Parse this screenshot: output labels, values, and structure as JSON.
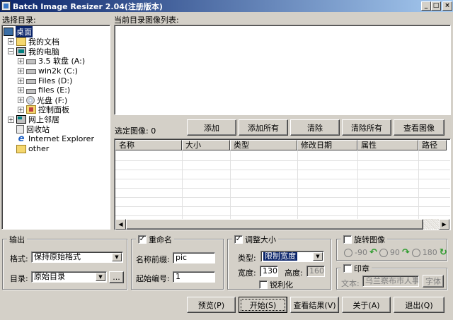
{
  "window": {
    "title": "Batch Image Resizer 2.04(注册版本)",
    "min_glyph": "_",
    "max_glyph": "□",
    "close_glyph": "×"
  },
  "left": {
    "header": "选择目录:",
    "tree": [
      {
        "label": "桌面",
        "icon": "desktop-icon",
        "level": 0,
        "expander": "",
        "selected": true
      },
      {
        "label": "我的文档",
        "icon": "folder-icon",
        "level": 1,
        "expander": "+"
      },
      {
        "label": "我的电脑",
        "icon": "computer-icon",
        "level": 1,
        "expander": "−"
      },
      {
        "label": "3.5 软盘 (A:)",
        "icon": "floppy-icon",
        "level": 2,
        "expander": "+"
      },
      {
        "label": "win2k (C:)",
        "icon": "drive-icon",
        "level": 2,
        "expander": "+"
      },
      {
        "label": "Files (D:)",
        "icon": "drive-icon",
        "level": 2,
        "expander": "+"
      },
      {
        "label": "files (E:)",
        "icon": "drive-icon",
        "level": 2,
        "expander": "+"
      },
      {
        "label": "光盘 (F:)",
        "icon": "cd-icon",
        "level": 2,
        "expander": "+"
      },
      {
        "label": "控制面板",
        "icon": "control-panel-icon",
        "level": 2,
        "expander": "+"
      },
      {
        "label": "网上邻居",
        "icon": "network-icon",
        "level": 1,
        "expander": "+"
      },
      {
        "label": "回收站",
        "icon": "recycle-bin-icon",
        "level": 1,
        "expander": ""
      },
      {
        "label": "Internet Explorer",
        "icon": "ie-icon",
        "level": 1,
        "expander": ""
      },
      {
        "label": "other",
        "icon": "folder-icon",
        "level": 1,
        "expander": ""
      }
    ]
  },
  "right": {
    "header": "当前目录图像列表:",
    "selected_label": "选定图像: 0",
    "buttons": {
      "add": "添加",
      "add_all": "添加所有",
      "clear": "清除",
      "clear_all": "清除所有",
      "view": "查看图像"
    },
    "columns": [
      "名称",
      "大小",
      "类型",
      "修改日期",
      "属性",
      "路径"
    ]
  },
  "output": {
    "title": "输出",
    "format_label": "格式:",
    "format_value": "保持原始格式",
    "dir_label": "目录:",
    "dir_value": "原始目录",
    "browse_label": "..."
  },
  "rename": {
    "title": "重命名",
    "checked": "✓",
    "prefix_label": "名称前缀:",
    "prefix_value": "pic",
    "start_label": "起始编号:",
    "start_value": "1"
  },
  "resize": {
    "title": "调整大小",
    "checked": "✓",
    "type_label": "类型:",
    "type_value": "限制宽度",
    "width_label": "宽度:",
    "width_value": "130",
    "height_label": "高度:",
    "height_value": "160",
    "sharpen_label": "锐利化"
  },
  "rotate": {
    "title": "旋转图像",
    "options": [
      "-90",
      "90",
      "180"
    ]
  },
  "stamp": {
    "title": "印章",
    "text_label": "文本:",
    "text_value": "乌兰察布市人事",
    "font_label": "字体"
  },
  "bottom": {
    "preview": "预览(P)",
    "start": "开始(S)",
    "results": "查看结果(V)",
    "about": "关于(A)",
    "exit": "退出(Q)"
  },
  "colors": {
    "selection": "#0a246a",
    "face": "#d4d0c8",
    "rotate_arrow": "#2e9c2e"
  }
}
